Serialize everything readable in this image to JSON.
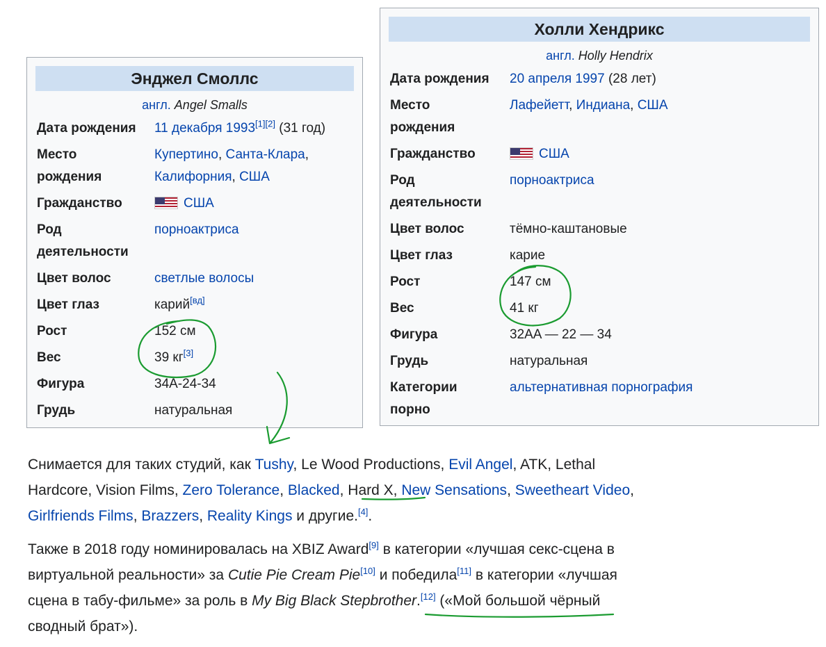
{
  "box1": {
    "title": "Энджел Смоллс",
    "sub_prefix": "англ.",
    "sub_name": "Angel Smalls",
    "rows": [
      {
        "key": "Дата рождения",
        "val": "11 декабря 1993",
        "ref1": "[1]",
        "ref2": "[2]",
        "extra": " (31 год)"
      },
      {
        "key": "Место рождения",
        "v1": "Купертино",
        "v2": "Санта-Клара",
        "v3": "Калифорния",
        "v4": "США"
      },
      {
        "key": "Гражданство",
        "val": "США"
      },
      {
        "key": "Род деятельности",
        "val": "порноактриса"
      },
      {
        "key": "Цвет волос",
        "val": "светлые волосы"
      },
      {
        "key": "Цвет глаз",
        "val": "карий",
        "ref": "[вд]"
      },
      {
        "key": "Рост",
        "val": "152 см"
      },
      {
        "key": "Вес",
        "val": "39 кг",
        "ref": "[3]"
      },
      {
        "key": "Фигура",
        "val": "34A-24-34"
      },
      {
        "key": "Грудь",
        "val": "натуральная"
      }
    ]
  },
  "box2": {
    "title": "Холли Хендрикс",
    "sub_prefix": "англ.",
    "sub_name": "Holly Hendrix",
    "rows": [
      {
        "key": "Дата рождения",
        "val": "20 апреля 1997",
        "extra": " (28 лет)"
      },
      {
        "key": "Место рождения",
        "v1": "Лафейетт",
        "v2": "Индиана",
        "v3": "США"
      },
      {
        "key": "Гражданство",
        "val": "США"
      },
      {
        "key": "Род деятельности",
        "val": "порноактриса"
      },
      {
        "key": "Цвет волос",
        "val": "тёмно-каштановые"
      },
      {
        "key": "Цвет глаз",
        "val": "карие"
      },
      {
        "key": "Рост",
        "val": "147 см"
      },
      {
        "key": "Вес",
        "val": "41 кг"
      },
      {
        "key": "Фигура",
        "val": "32AA — 22 — 34"
      },
      {
        "key": "Грудь",
        "val": "натуральная"
      },
      {
        "key": "Категории порно",
        "val": "альтернативная порнография"
      }
    ]
  },
  "para1": {
    "t0": "Снимается для таких студий, как ",
    "l_tushy": "Tushy",
    "t1": ", Le Wood Productions, ",
    "l_evil": "Evil Angel",
    "t2": ", ATK, Lethal Hardcore, Vision Films, ",
    "l_zero": "Zero Tolerance",
    "t3": ", ",
    "l_blacked": "Blacked",
    "t4": ", Hard X, ",
    "l_newsens": "New Sensations",
    "t5": ", ",
    "l_sweet": "Sweetheart Video",
    "t6": ", ",
    "l_girl": "Girlfriends Films",
    "t7": ", ",
    "l_brazz": "Brazzers",
    "t8": ", ",
    "l_reality": "Reality Kings",
    "t9": " и другие.",
    "ref": "[4]",
    "t10": "."
  },
  "para2": {
    "t0": "Также в 2018 году номинировалась на XBIZ Award",
    "ref9": "[9]",
    "t1": " в категории «лучшая секс-сцена в виртуальной реальности» за ",
    "film1": "Cutie Pie Cream Pie",
    "ref10": "[10]",
    "t2": " и победила",
    "ref11": "[11]",
    "t3": " в категории «лучшая сцена в табу-фильме» за роль в ",
    "film2": "My Big Black Stepbrother",
    "t4": ".",
    "ref12": "[12]",
    "t5": " («Мой большой чёрный сводный брат»)."
  },
  "colors": {
    "link": "#0645ad",
    "annotation": "#1a9b30",
    "infobox_bg": "#f8f9fa",
    "title_bg": "#cedff2"
  }
}
